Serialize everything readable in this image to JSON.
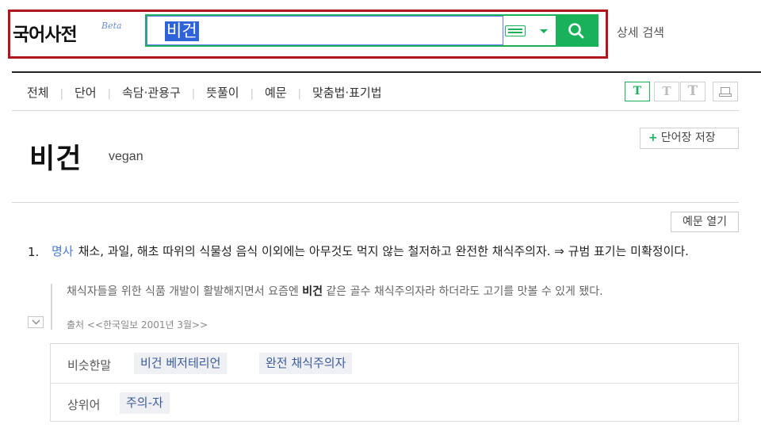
{
  "header": {
    "logo": "국어사전",
    "beta": "Beta",
    "search_value": "비건",
    "detail_search": "상세 검색"
  },
  "tabs": [
    {
      "label": "전체"
    },
    {
      "label": "단어"
    },
    {
      "label": "속담·관용구"
    },
    {
      "label": "뜻풀이"
    },
    {
      "label": "예문"
    },
    {
      "label": "맞춤법·표기법"
    }
  ],
  "font_size_buttons": [
    {
      "label": "T",
      "active": true
    },
    {
      "label": "T",
      "active": false
    },
    {
      "label": "T",
      "active": false
    }
  ],
  "entry": {
    "save_label": "단어장 저장",
    "save_plus": "+",
    "headword": "비건",
    "original": "vegan",
    "example_toggle": "예문 열기",
    "definitions": [
      {
        "number": "1.",
        "pos": "명사",
        "text": "채소, 과일, 해초 따위의 식물성 음식 이외에는 아무것도 먹지 않는 철저하고 완전한 채식주의자. ⇒ 규범 표기는 미확정이다.",
        "example": {
          "before": "채식자들을 위한 식품 개발이 활발해지면서 요즘엔 ",
          "highlight": "비건",
          "after": " 같은 골수 채식주의자라 하더라도 고기를 맛볼 수 있게 됐다.",
          "source": "출처 <<한국일보 2001년 3월>>"
        }
      }
    ]
  },
  "relations": [
    {
      "label": "비슷한말",
      "words": [
        "비건 베저테리언",
        "완전 채식주의자"
      ]
    },
    {
      "label": "상위어",
      "words": [
        "주의-자"
      ]
    }
  ],
  "colors": {
    "accent": "#19b15a",
    "highlight_outline": "#b3141c",
    "pos_blue": "#4a7bd0"
  }
}
